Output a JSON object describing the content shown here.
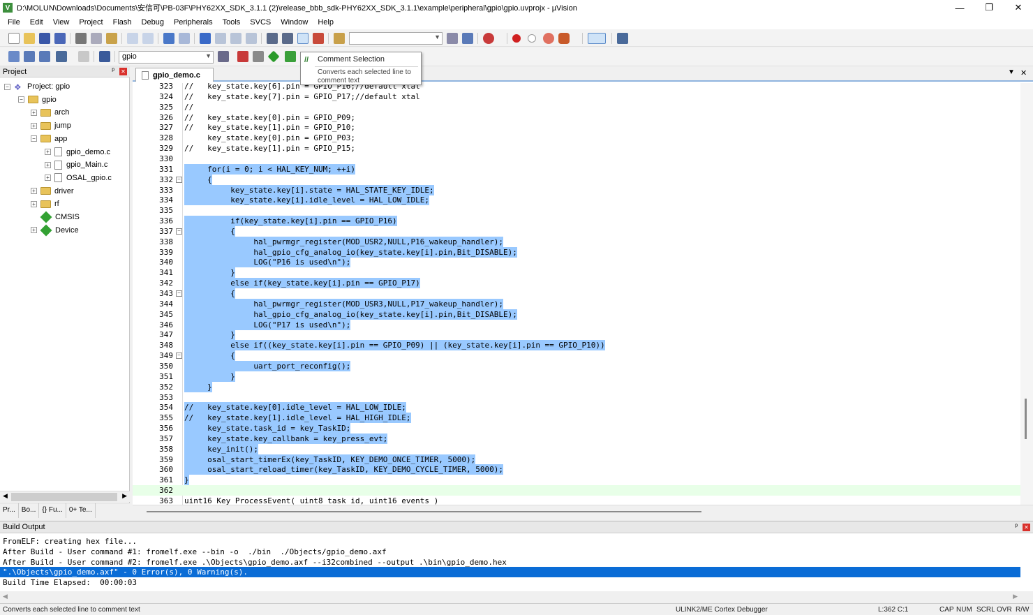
{
  "window": {
    "title": "D:\\MOLUN\\Downloads\\Documents\\安信可\\PB-03F\\PHY62XX_SDK_3.1.1 (2)\\release_bbb_sdk-PHY62XX_SDK_3.1.1\\example\\peripheral\\gpio\\gpio.uvprojx - µVision",
    "minimize": "—",
    "maximize": "❐",
    "close": "✕"
  },
  "menu": [
    "File",
    "Edit",
    "View",
    "Project",
    "Flash",
    "Debug",
    "Peripherals",
    "Tools",
    "SVCS",
    "Window",
    "Help"
  ],
  "toolbar": {
    "target_combo": "gpio"
  },
  "tooltip": {
    "title": "Comment Selection",
    "body": "Converts each selected line to comment text"
  },
  "project_panel": {
    "title": "Project",
    "pin": "ᵖ",
    "close": "✕",
    "tree": [
      {
        "label": "Project: gpio",
        "type": "project",
        "level": 0,
        "expander": "−"
      },
      {
        "label": "gpio",
        "type": "folder",
        "level": 1,
        "expander": "−"
      },
      {
        "label": "arch",
        "type": "folder",
        "level": 2,
        "expander": "+"
      },
      {
        "label": "jump",
        "type": "folder",
        "level": 2,
        "expander": "+"
      },
      {
        "label": "app",
        "type": "folder",
        "level": 2,
        "expander": "−"
      },
      {
        "label": "gpio_demo.c",
        "type": "file",
        "level": 3,
        "expander": "+"
      },
      {
        "label": "gpio_Main.c",
        "type": "file",
        "level": 3,
        "expander": "+"
      },
      {
        "label": "OSAL_gpio.c",
        "type": "file",
        "level": 3,
        "expander": "+"
      },
      {
        "label": "driver",
        "type": "folder",
        "level": 2,
        "expander": "+"
      },
      {
        "label": "rf",
        "type": "folder",
        "level": 2,
        "expander": "+"
      },
      {
        "label": "CMSIS",
        "type": "component",
        "level": 2,
        "expander": ""
      },
      {
        "label": "Device",
        "type": "component",
        "level": 2,
        "expander": "+"
      }
    ],
    "tabs": [
      "Pr...",
      "Bo...",
      "{} Fu...",
      "0+ Te..."
    ]
  },
  "editor": {
    "active_tab": "gpio_demo.c",
    "dropdown": "▼",
    "close": "✕",
    "lines": [
      {
        "n": "323",
        "text": "//   key_state.key[6].pin = GPIO_P16;//default xtal",
        "sel": false,
        "fold": ""
      },
      {
        "n": "324",
        "text": "//   key_state.key[7].pin = GPIO_P17;//default xtal",
        "sel": false,
        "fold": ""
      },
      {
        "n": "325",
        "text": "//",
        "sel": false,
        "fold": ""
      },
      {
        "n": "326",
        "text": "//   key_state.key[0].pin = GPIO_P09;",
        "sel": false,
        "fold": ""
      },
      {
        "n": "327",
        "text": "//   key_state.key[1].pin = GPIO_P10;",
        "sel": false,
        "fold": ""
      },
      {
        "n": "328",
        "text": "     key_state.key[0].pin = GPIO_P03;",
        "sel": false,
        "fold": ""
      },
      {
        "n": "329",
        "text": "//   key_state.key[1].pin = GPIO_P15;",
        "sel": false,
        "fold": ""
      },
      {
        "n": "330",
        "text": "",
        "sel": false,
        "fold": ""
      },
      {
        "n": "331",
        "text": "     for(i = 0; i < HAL_KEY_NUM; ++i)",
        "sel": true,
        "fold": ""
      },
      {
        "n": "332",
        "text": "     {",
        "sel": true,
        "fold": "−"
      },
      {
        "n": "333",
        "text": "          key_state.key[i].state = HAL_STATE_KEY_IDLE;",
        "sel": true,
        "fold": ""
      },
      {
        "n": "334",
        "text": "          key_state.key[i].idle_level = HAL_LOW_IDLE;",
        "sel": true,
        "fold": ""
      },
      {
        "n": "335",
        "text": "",
        "sel": true,
        "fold": ""
      },
      {
        "n": "336",
        "text": "          if(key_state.key[i].pin == GPIO_P16)",
        "sel": true,
        "fold": ""
      },
      {
        "n": "337",
        "text": "          {",
        "sel": true,
        "fold": "−"
      },
      {
        "n": "338",
        "text": "               hal_pwrmgr_register(MOD_USR2,NULL,P16_wakeup_handler);",
        "sel": true,
        "fold": ""
      },
      {
        "n": "339",
        "text": "               hal_gpio_cfg_analog_io(key_state.key[i].pin,Bit_DISABLE);",
        "sel": true,
        "fold": ""
      },
      {
        "n": "340",
        "text": "               LOG(\"P16 is used\\n\");",
        "sel": true,
        "fold": ""
      },
      {
        "n": "341",
        "text": "          }",
        "sel": true,
        "fold": ""
      },
      {
        "n": "342",
        "text": "          else if(key_state.key[i].pin == GPIO_P17)",
        "sel": true,
        "fold": ""
      },
      {
        "n": "343",
        "text": "          {",
        "sel": true,
        "fold": "−"
      },
      {
        "n": "344",
        "text": "               hal_pwrmgr_register(MOD_USR3,NULL,P17_wakeup_handler);",
        "sel": true,
        "fold": ""
      },
      {
        "n": "345",
        "text": "               hal_gpio_cfg_analog_io(key_state.key[i].pin,Bit_DISABLE);",
        "sel": true,
        "fold": ""
      },
      {
        "n": "346",
        "text": "               LOG(\"P17 is used\\n\");",
        "sel": true,
        "fold": ""
      },
      {
        "n": "347",
        "text": "          }",
        "sel": true,
        "fold": ""
      },
      {
        "n": "348",
        "text": "          else if((key_state.key[i].pin == GPIO_P09) || (key_state.key[i].pin == GPIO_P10))",
        "sel": true,
        "fold": ""
      },
      {
        "n": "349",
        "text": "          {",
        "sel": true,
        "fold": "−"
      },
      {
        "n": "350",
        "text": "               uart_port_reconfig();",
        "sel": true,
        "fold": ""
      },
      {
        "n": "351",
        "text": "          }",
        "sel": true,
        "fold": ""
      },
      {
        "n": "352",
        "text": "     }",
        "sel": true,
        "fold": ""
      },
      {
        "n": "353",
        "text": "",
        "sel": true,
        "fold": ""
      },
      {
        "n": "354",
        "text": "//   key_state.key[0].idle_level = HAL_LOW_IDLE;",
        "sel": true,
        "fold": ""
      },
      {
        "n": "355",
        "text": "//   key_state.key[1].idle_level = HAL_HIGH_IDLE;",
        "sel": true,
        "fold": ""
      },
      {
        "n": "356",
        "text": "     key_state.task_id = key_TaskID;",
        "sel": true,
        "fold": ""
      },
      {
        "n": "357",
        "text": "     key_state.key_callbank = key_press_evt;",
        "sel": true,
        "fold": ""
      },
      {
        "n": "358",
        "text": "     key_init();",
        "sel": true,
        "fold": ""
      },
      {
        "n": "359",
        "text": "     osal_start_timerEx(key_TaskID, KEY_DEMO_ONCE_TIMER, 5000);",
        "sel": true,
        "fold": ""
      },
      {
        "n": "360",
        "text": "     osal_start_reload_timer(key_TaskID, KEY_DEMO_CYCLE_TIMER, 5000);",
        "sel": true,
        "fold": ""
      },
      {
        "n": "361",
        "text": "}",
        "sel": true,
        "fold": ""
      },
      {
        "n": "362",
        "text": "",
        "sel": false,
        "fold": "",
        "current": true
      },
      {
        "n": "363",
        "text": "uint16 Key_ProcessEvent( uint8 task_id, uint16 events )",
        "sel": false,
        "fold": ""
      }
    ]
  },
  "build_output": {
    "title": "Build Output",
    "pin": "ᵖ",
    "close": "✕",
    "lines": [
      {
        "text": "FromELF: creating hex file...",
        "hl": false
      },
      {
        "text": "After Build - User command #1: fromelf.exe --bin -o  ./bin  ./Objects/gpio_demo.axf",
        "hl": false
      },
      {
        "text": "After Build - User command #2: fromelf.exe .\\Objects\\gpio_demo.axf --i32combined --output .\\bin\\gpio_demo.hex",
        "hl": false
      },
      {
        "text": "\".\\Objects\\gpio_demo.axf\" - 0 Error(s), 0 Warning(s).",
        "hl": true
      },
      {
        "text": "Build Time Elapsed:  00:00:03",
        "hl": false
      }
    ]
  },
  "status": {
    "message": "Converts each selected line to comment text",
    "debugger": "ULINK2/ME Cortex Debugger",
    "position": "L:362 C:1",
    "cap": "CAP",
    "num": "NUM",
    "scrl": "SCRL",
    "ovr": "OVR",
    "rw": "R/W"
  },
  "colors": {
    "selection": "#99c9ff",
    "current_line": "#e8ffe8",
    "build_highlight": "#0a6cd6"
  }
}
